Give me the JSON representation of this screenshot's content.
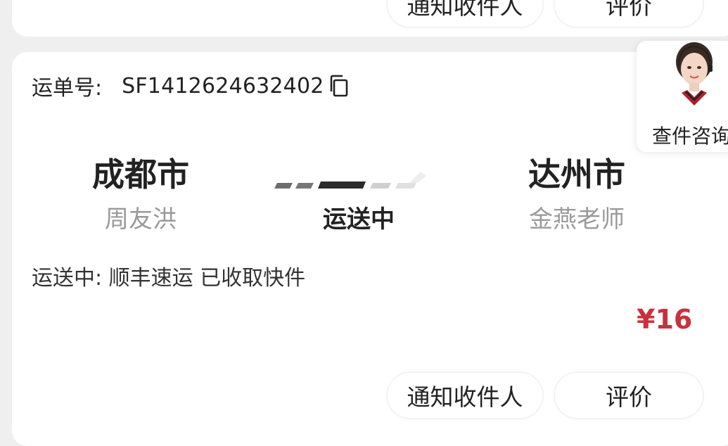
{
  "top_card": {
    "notify_label": "通知收件人",
    "review_label": "评价"
  },
  "order": {
    "waybill_label": "运单号:",
    "waybill_number": "SF1412624632402",
    "origin_city": "成都市",
    "sender": "周友洪",
    "destination_city": "达州市",
    "recipient": "金燕老师",
    "status": "运送中",
    "status_detail": "运送中: 顺丰速运 已收取快件",
    "price": "¥16",
    "notify_label": "通知收件人",
    "review_label": "评价"
  },
  "support": {
    "label": "查件咨询"
  },
  "colors": {
    "price": "#c8323c",
    "muted_text": "#9a9a9a",
    "background": "#efefef"
  },
  "icons": [
    "copy-icon",
    "customer-service-avatar",
    "route-progress-icon"
  ]
}
